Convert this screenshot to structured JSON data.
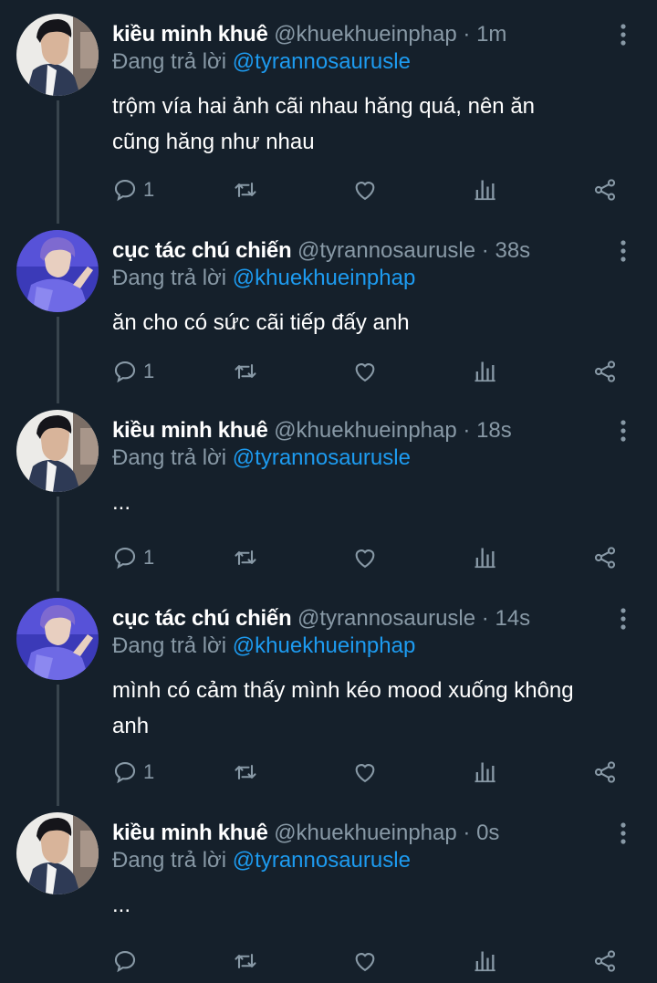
{
  "labels": {
    "replying_prefix": "Đang trả lời"
  },
  "tweets": [
    {
      "author": "kiều minh khuê",
      "handle": "@khuekhueinphap",
      "separator": "·",
      "time": "1m",
      "replying_to": "@tyrannosaurusle",
      "text_lines": [
        "trộm vía hai ảnh cãi nhau hăng quá, nên ăn",
        "cũng hăng như nhau"
      ],
      "reply_count": "1",
      "avatar_style": "man-suit"
    },
    {
      "author": "cục tác chú chiến",
      "handle": "@tyrannosaurusle",
      "separator": "·",
      "time": "38s",
      "replying_to": "@khuekhueinphap",
      "text_lines": [
        "ăn cho có sức cãi tiếp đấy anh"
      ],
      "reply_count": "1",
      "avatar_style": "blue-boy"
    },
    {
      "author": "kiều minh khuê",
      "handle": "@khuekhueinphap",
      "separator": "·",
      "time": "18s",
      "replying_to": "@tyrannosaurusle",
      "text_lines": [
        "..."
      ],
      "reply_count": "1",
      "avatar_style": "man-suit"
    },
    {
      "author": "cục tác chú chiến",
      "handle": "@tyrannosaurusle",
      "separator": "·",
      "time": "14s",
      "replying_to": "@khuekhueinphap",
      "text_lines": [
        "mình có cảm thấy mình kéo mood xuống không",
        "anh"
      ],
      "reply_count": "1",
      "avatar_style": "blue-boy"
    },
    {
      "author": "kiều minh khuê",
      "handle": "@khuekhueinphap",
      "separator": "·",
      "time": "0s",
      "replying_to": "@tyrannosaurusle",
      "text_lines": [
        "..."
      ],
      "reply_count": "",
      "avatar_style": "man-suit"
    }
  ],
  "colors": {
    "background": "#15202b",
    "secondary_text": "#8899a6",
    "mention": "#1d9bf0",
    "thread_line": "#38444d"
  },
  "icons": {
    "more": "more-vertical-icon",
    "reply": "reply-icon",
    "retweet": "retweet-icon",
    "like": "heart-icon",
    "analytics": "analytics-icon",
    "share": "share-icon"
  }
}
